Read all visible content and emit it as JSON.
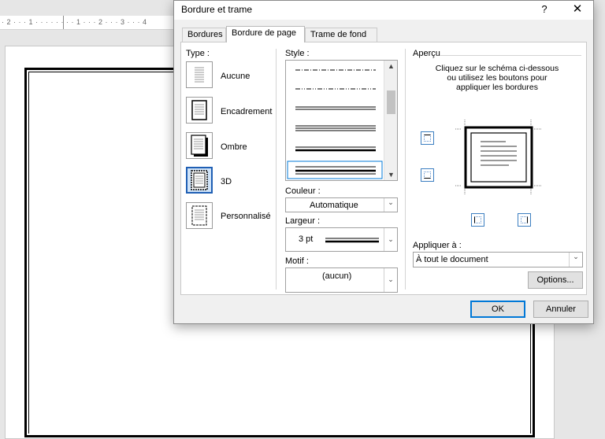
{
  "ruler_text": "· 2 · · · 1 · · · · · · · · 1 · · · 2 · · · 3 · · · 4",
  "dialog": {
    "title": "Bordure et trame",
    "help": "?",
    "close": "✕",
    "tabs": {
      "borders": "Bordures",
      "page_border": "Bordure de page",
      "shading": "Trame de fond"
    },
    "type": {
      "label": "Type :",
      "items": [
        "Aucune",
        "Encadrement",
        "Ombre",
        "3D",
        "Personnalisé"
      ]
    },
    "style": {
      "label": "Style :"
    },
    "color": {
      "label": "Couleur :",
      "value": "Automatique"
    },
    "width": {
      "label": "Largeur :",
      "value": "3 pt"
    },
    "art": {
      "label": "Motif :",
      "value": "(aucun)"
    },
    "preview": {
      "label": "Aperçu",
      "hint": "Cliquez sur le schéma ci-dessous ou utilisez les boutons pour appliquer les bordures"
    },
    "apply": {
      "label": "Appliquer à :",
      "value": "À tout le document"
    },
    "buttons": {
      "options": "Options...",
      "ok": "OK",
      "cancel": "Annuler"
    }
  }
}
